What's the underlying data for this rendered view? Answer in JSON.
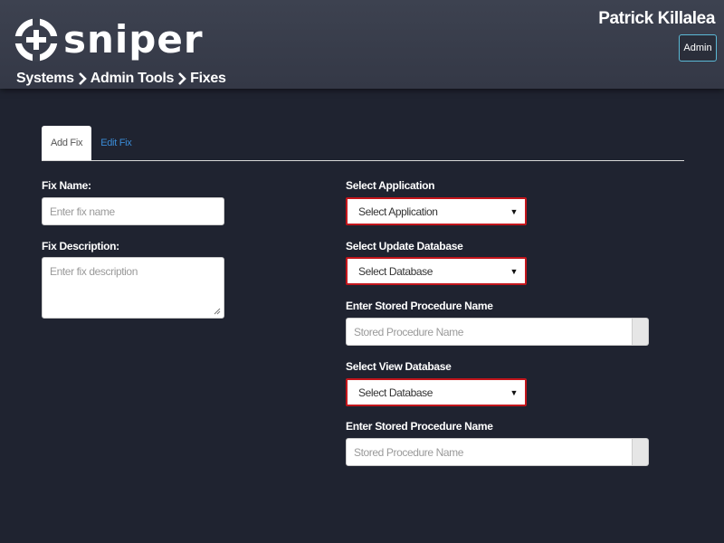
{
  "header": {
    "logo_text": "sniper",
    "logo_icon": "sniper-crosshair-logo",
    "breadcrumb": [
      "Systems",
      "Admin Tools",
      "Fixes"
    ],
    "breadcrumb_separator_icon": "chevron-right-icon",
    "user_name": "Patrick Killalea",
    "admin_label": "Admin"
  },
  "tabs": [
    {
      "label": "Add Fix",
      "active": true
    },
    {
      "label": "Edit Fix",
      "active": false
    }
  ],
  "form": {
    "fix_name": {
      "label": "Fix Name:",
      "placeholder": "Enter fix name",
      "value": ""
    },
    "fix_description": {
      "label": "Fix Description:",
      "placeholder": "Enter fix description",
      "value": ""
    },
    "select_application": {
      "label": "Select Application",
      "selected": "Select Application"
    },
    "select_update_database": {
      "label": "Select Update Database",
      "selected": "Select Database"
    },
    "update_stored_procedure": {
      "label": "Enter Stored Procedure Name",
      "placeholder": "Stored Procedure Name",
      "value": ""
    },
    "select_view_database": {
      "label": "Select View Database",
      "selected": "Select Database"
    },
    "view_stored_procedure": {
      "label": "Enter Stored Procedure Name",
      "placeholder": "Stored Procedure Name",
      "value": ""
    }
  },
  "colors": {
    "page_background": "#1f2330",
    "header_background": "#3a3f4c",
    "select_border": "#c3161c",
    "admin_border": "#5bb9d6",
    "tab_link": "#3a8bd6"
  }
}
